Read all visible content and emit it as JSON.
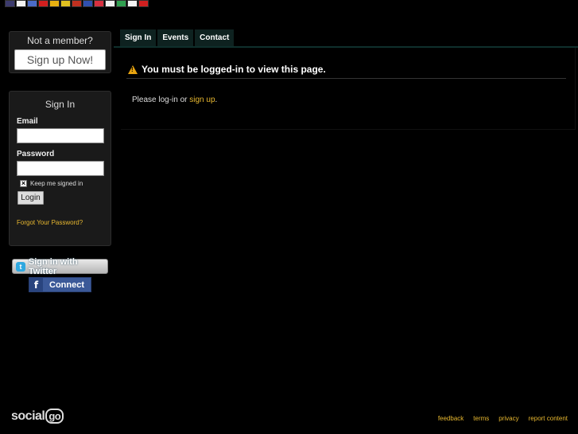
{
  "flags": [
    {
      "name": "us-flag-icon",
      "color": "#3c3b6e"
    },
    {
      "name": "korea-flag-icon",
      "color": "#f2f2f2"
    },
    {
      "name": "france-flag-icon",
      "color": "#4a6bc8"
    },
    {
      "name": "china-flag-icon",
      "color": "#d21f1f"
    },
    {
      "name": "spain-flag-icon",
      "color": "#e8b010"
    },
    {
      "name": "romania-flag-icon",
      "color": "#e0c020"
    },
    {
      "name": "germany-flag-icon",
      "color": "#c03020"
    },
    {
      "name": "russia-flag-icon",
      "color": "#3050b0"
    },
    {
      "name": "poland-flag-icon",
      "color": "#d83040"
    },
    {
      "name": "finland-flag-icon",
      "color": "#f0f0f0"
    },
    {
      "name": "italy-flag-icon",
      "color": "#30a050"
    },
    {
      "name": "japan-flag-icon",
      "color": "#f4f4f4"
    },
    {
      "name": "portugal-flag-icon",
      "color": "#d02020"
    }
  ],
  "member_box": {
    "title": "Not a member?",
    "signup_label": "Sign up Now!"
  },
  "signin": {
    "title": "Sign In",
    "email_label": "Email",
    "password_label": "Password",
    "keep_signed_in": "Keep me signed in",
    "login_label": "Login",
    "forgot": "Forgot Your Password?"
  },
  "social": {
    "twitter": "Sign in with Twitter",
    "facebook_icon": "f",
    "facebook": "Connect"
  },
  "tabs": [
    "Sign In",
    "Events",
    "Contact"
  ],
  "main": {
    "alert": "You must be logged-in to view this page.",
    "msg_prefix": "Please log-in or ",
    "msg_link": "sign up",
    "msg_suffix": "."
  },
  "footer": {
    "logo_text": "social",
    "logo_go": "go",
    "links": [
      "feedback",
      "terms",
      "privacy",
      "report content"
    ]
  },
  "colors": {
    "accent": "#e8b830",
    "tab_bg": "#0e2220"
  }
}
